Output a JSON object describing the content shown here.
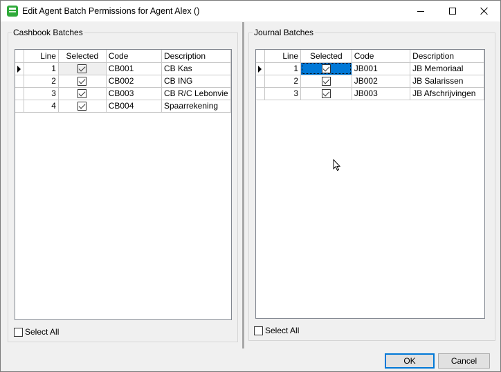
{
  "window": {
    "title": "Edit Agent Batch Permissions for Agent Alex ()",
    "controls": [
      "minimize",
      "maximize",
      "close"
    ]
  },
  "cashbook": {
    "label": "Cashbook Batches",
    "columns": [
      "Line",
      "Selected",
      "Code",
      "Description"
    ],
    "rows": [
      {
        "line": "1",
        "selected": true,
        "code": "CB001",
        "description": "CB Kas"
      },
      {
        "line": "2",
        "selected": true,
        "code": "CB002",
        "description": "CB ING"
      },
      {
        "line": "3",
        "selected": true,
        "code": "CB003",
        "description": "CB R/C Lebonvie"
      },
      {
        "line": "4",
        "selected": true,
        "code": "CB004",
        "description": "Spaarrekening"
      }
    ],
    "select_all": "Select All"
  },
  "journal": {
    "label": "Journal Batches",
    "columns": [
      "Line",
      "Selected",
      "Code",
      "Description"
    ],
    "rows": [
      {
        "line": "1",
        "selected": true,
        "code": "JB001",
        "description": "JB Memoriaal"
      },
      {
        "line": "2",
        "selected": true,
        "code": "JB002",
        "description": "JB Salarissen"
      },
      {
        "line": "3",
        "selected": true,
        "code": "JB003",
        "description": "JB Afschrijvingen"
      }
    ],
    "select_all": "Select All"
  },
  "buttons": {
    "ok": "OK",
    "cancel": "Cancel"
  },
  "colors": {
    "focus_blue": "#0078d7",
    "app_icon_green": "#2faa3a"
  }
}
